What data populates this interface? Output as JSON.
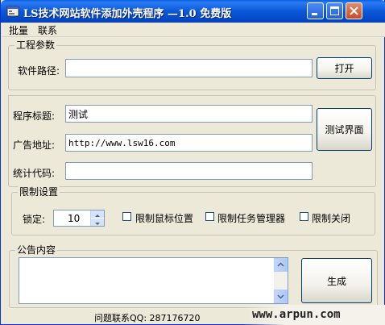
{
  "window": {
    "title": "LS技术网站软件添加外壳程序 —1.0 免费版"
  },
  "menu": {
    "items": [
      "批量",
      "联系"
    ]
  },
  "project": {
    "group_label": "工程参数",
    "path_label": "软件路径:",
    "path_value": "",
    "open_button": "打开"
  },
  "form": {
    "title_label": "程序标题:",
    "title_value": "测试",
    "ad_label": "广告地址:",
    "ad_value": "http://www.lsw16.com",
    "stats_label": "统计代码:",
    "stats_value": "",
    "test_button": "测试界面"
  },
  "limits": {
    "group_label": "限制设置",
    "lock_label": "锁定:",
    "lock_value": "10",
    "options": [
      "限制鼠标位置",
      "限制任务管理器",
      "限制关闭"
    ]
  },
  "notice": {
    "group_label": "公告内容",
    "content": "",
    "generate_button": "生成"
  },
  "status": {
    "text": "问题联系QQ: 287176720"
  },
  "watermark": {
    "text": "www.arpun.com"
  },
  "colors": {
    "titlebar": "#0b58d8",
    "window_bg": "#ece9d8",
    "input_border": "#7f9db9"
  }
}
